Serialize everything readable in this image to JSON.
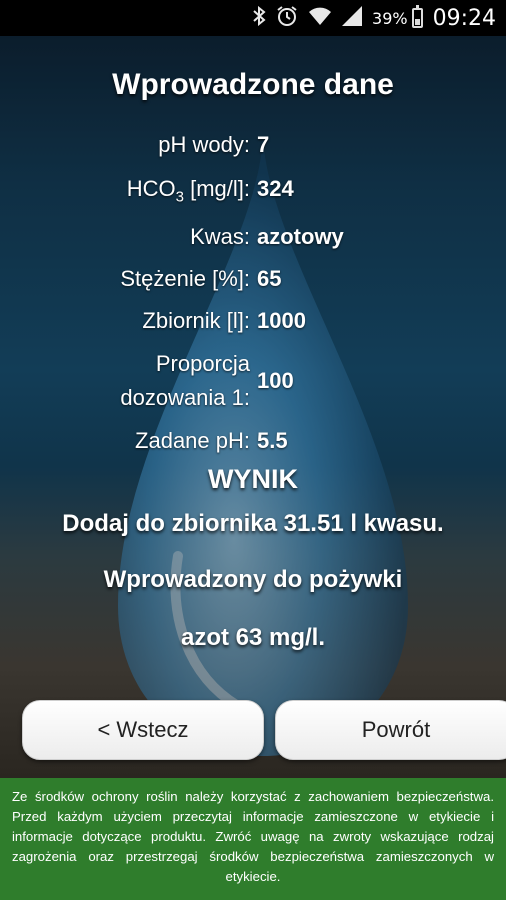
{
  "statusbar": {
    "icons": [
      "bluetooth-icon",
      "alarm-icon",
      "wifi-icon",
      "signal-icon",
      "battery-icon"
    ],
    "battery_percent": "39%",
    "battery_level": 0.39,
    "time": "09:24"
  },
  "summary": {
    "title": "Wprowadzone dane",
    "rows": [
      {
        "label": "pH wody:",
        "value": "7"
      },
      {
        "label_prefix": "HCO",
        "label_sub": "3",
        "label_suffix": " [mg/l]:",
        "value": "324"
      },
      {
        "label": "Kwas:",
        "value": "azotowy"
      },
      {
        "label": "Stężenie [%]:",
        "value": "65"
      },
      {
        "label": "Zbiornik [l]:",
        "value": "1000"
      },
      {
        "label_line1": "Proporcja",
        "label_line2": "dozowania 1:",
        "value": "100"
      },
      {
        "label": "Zadane pH:",
        "value": "5.5"
      }
    ]
  },
  "result": {
    "heading": "WYNIK",
    "line1": "Dodaj do zbiornika 31.51 l kwasu.",
    "line2": "Wprowadzony do pożywki",
    "line3": "azot 63 mg/l."
  },
  "buttons": {
    "back_label": "< Wstecz",
    "return_label": "Powrót"
  },
  "footer": {
    "text": "Ze środków ochrony roślin należy korzystać z zachowaniem bezpieczeństwa. Przed każdym użyciem przeczytaj informacje zamieszczone w etykiecie i informacje dotyczące produktu. Zwróć uwagę na zwroty wskazujące rodzaj zagrożenia oraz przestrzegaj środków bezpieczeństwa zamieszczonych w etykiecie."
  },
  "colors": {
    "footer_bg": "#2f7d2c",
    "button_bg": "#ffffff"
  }
}
